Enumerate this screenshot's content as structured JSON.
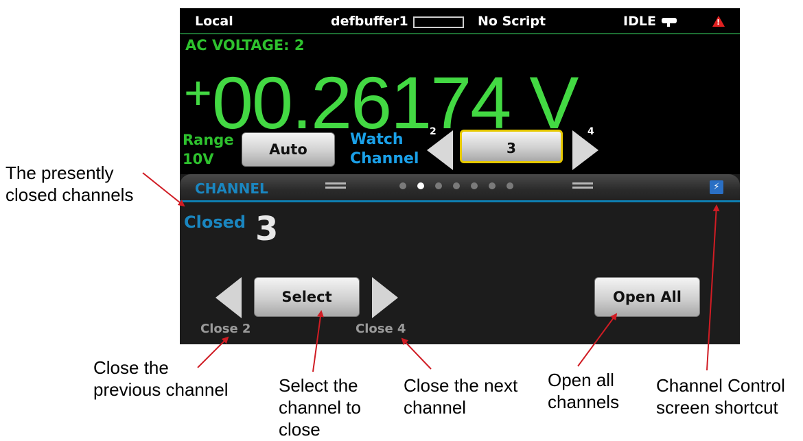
{
  "status_bar": {
    "mode": "Local",
    "buffer": "defbuffer1",
    "script": "No Script",
    "state": "IDLE"
  },
  "measurement": {
    "function": "AC VOLTAGE: 2",
    "sign": "+",
    "value": "00.26174 V"
  },
  "range": {
    "label": "Range",
    "value": "10V",
    "button": "Auto"
  },
  "watch_channel": {
    "label_line1": "Watch",
    "label_line2": "Channel",
    "value": "3",
    "prev_number": "2",
    "next_number": "4"
  },
  "panel": {
    "title": "CHANNEL",
    "page_count": 7,
    "active_page": 2,
    "closed_label": "Closed",
    "closed_value": "3",
    "select_button": "Select",
    "open_all_button": "Open All",
    "close_prev_label": "Close 2",
    "close_next_label": "Close 4"
  },
  "annotations": {
    "closed_channels": [
      "The presently",
      "closed channels"
    ],
    "close_previous": [
      "Close the",
      "previous channel"
    ],
    "select_channel": [
      "Select the",
      "channel to",
      "close"
    ],
    "close_next": [
      "Close the next",
      "channel"
    ],
    "open_all": [
      "Open all",
      "channels"
    ],
    "channel_control": [
      "Channel Control",
      "screen shortcut"
    ]
  },
  "colors": {
    "reading": "#43d943",
    "label_green": "#2ec22e",
    "label_blue": "#1aa0e8",
    "panel_accent": "#0e7fb2",
    "arrow_red": "#d01c24",
    "warning": "#e02020"
  }
}
